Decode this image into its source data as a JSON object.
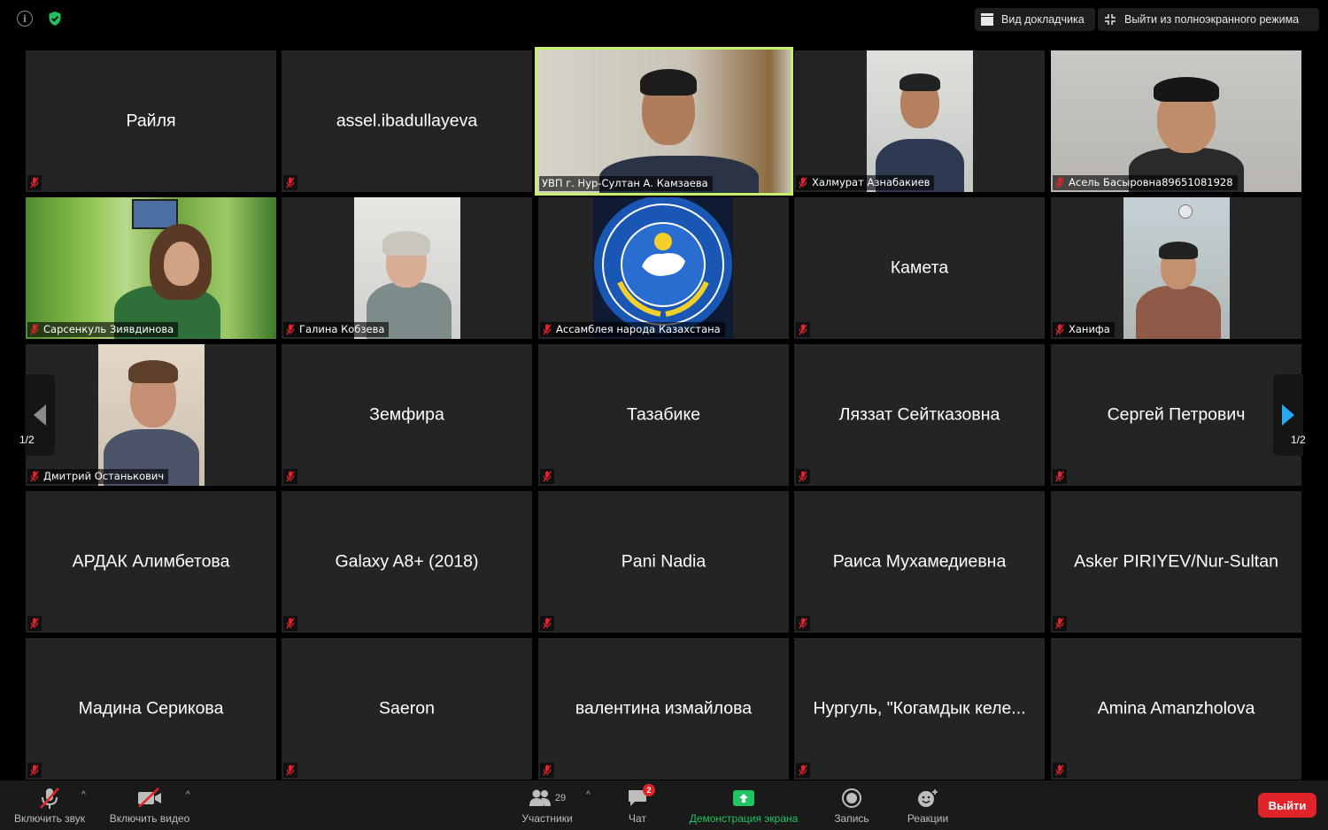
{
  "topbar": {
    "speaker_view": "Вид докладчика",
    "exit_fullscreen": "Выйти из полноэкранного режима"
  },
  "tiles": {
    "r1c1": "Райля",
    "r1c2": "assel.ibadullayeva",
    "r1c3": "УВП г. Нур-Султан А. Камзаева",
    "r1c4": "Халмурат Азнабакиев",
    "r1c5": "Асель Басыровна89651081928",
    "r2c1": "Сарсенкуль Зиявдинова",
    "r2c2": "Галина  Кобзева",
    "r2c3": "Ассамблея народа Казахстана",
    "r2c4": "Камета",
    "r2c5": "Ханифа",
    "r3c1": "Дмитрий Останькович",
    "r3c2": "Земфира",
    "r3c3": "Тазабике",
    "r3c4": "Ляззат Сейтказовна",
    "r3c5": "Сергей Петрович",
    "r4c1": "АРДАК Алимбетова",
    "r4c2": "Galaxy A8+ (2018)",
    "r4c3": "Pani Nadia",
    "r4c4": "Раиса Мухамедиевна",
    "r4c5": "Asker PIRIYEV/Nur-Sultan",
    "r5c1": "Мадина Серикова",
    "r5c2": "Saeron",
    "r5c3": "валентина измайлова",
    "r5c4": "Нургуль, \"Когамдык келе...",
    "r5c5": "Amina Amanzholova"
  },
  "pager": {
    "left": "1/2",
    "right": "1/2"
  },
  "bottombar": {
    "unmute": "Включить звук",
    "start_video": "Включить видео",
    "participants": "Участники",
    "participants_count": "29",
    "chat": "Чат",
    "chat_badge": "2",
    "share": "Демонстрация экрана",
    "record": "Запись",
    "reactions": "Реакции",
    "leave": "Выйти"
  },
  "colors": {
    "active_speaker": "#c6f06a",
    "muted": "#e0242a",
    "share": "#20c463",
    "nav_arrow": "#29a8f0"
  }
}
